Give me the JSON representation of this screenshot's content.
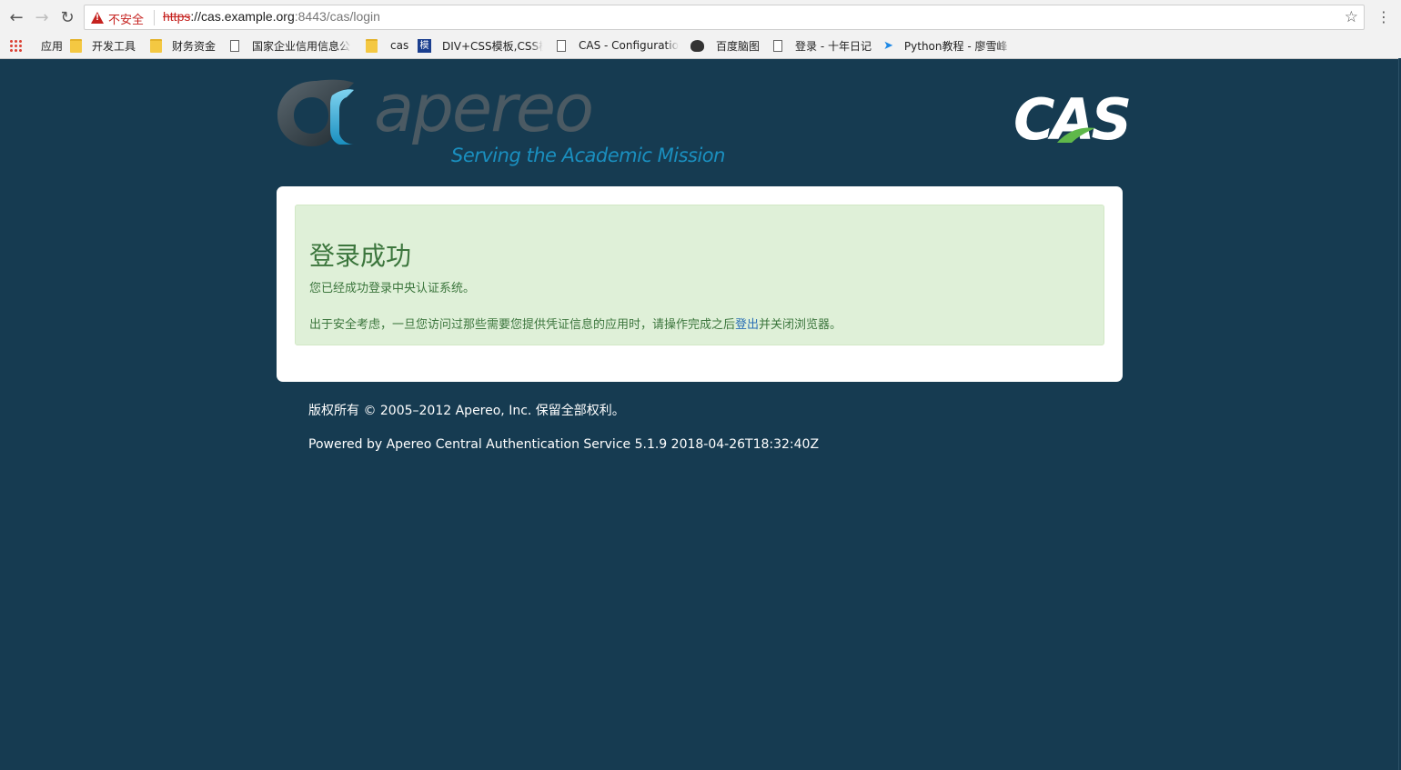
{
  "browser": {
    "security_label": "不安全",
    "url_scheme": "https",
    "url_host": "://cas.example.org",
    "url_tail": ":8443/cas/login",
    "bookmarks": [
      {
        "label": "应用",
        "icon": "apps-grid-icon"
      },
      {
        "label": "开发工具",
        "icon": "folder-icon"
      },
      {
        "label": "财务资金",
        "icon": "folder-icon"
      },
      {
        "label": "国家企业信用信息公",
        "icon": "page-icon"
      },
      {
        "label": "cas",
        "icon": "folder-icon"
      },
      {
        "label": "DIV+CSS模板,CSS模",
        "icon": "template-site-icon"
      },
      {
        "label": "CAS - Configuratio",
        "icon": "page-icon"
      },
      {
        "label": "百度脑图",
        "icon": "owl-icon"
      },
      {
        "label": "登录 - 十年日记",
        "icon": "page-icon"
      },
      {
        "label": "Python教程 - 廖雪峰",
        "icon": "rocket-icon"
      }
    ]
  },
  "header": {
    "apereo_word": "apereo",
    "apereo_tagline": "Serving the Academic Mission",
    "cas_word": "CAS"
  },
  "alert": {
    "title": "登录成功",
    "line1": "您已经成功登录中央认证系统。",
    "line2_before": "出于安全考虑，一旦您访问过那些需要您提供凭证信息的应用时，请操作完成之后",
    "line2_link": "登出",
    "line2_after": "并关闭浏览器。"
  },
  "footer": {
    "copyright": "版权所有 © 2005–2012 Apereo, Inc. 保留全部权利。",
    "powered": "Powered by Apereo Central Authentication Service 5.1.9 2018-04-26T18:32:40Z"
  },
  "colors": {
    "page_bg": "#163b51",
    "alert_bg": "#dff0d8",
    "alert_text": "#3c763d",
    "link": "#2a6fb5",
    "insecure": "#c5221f"
  }
}
